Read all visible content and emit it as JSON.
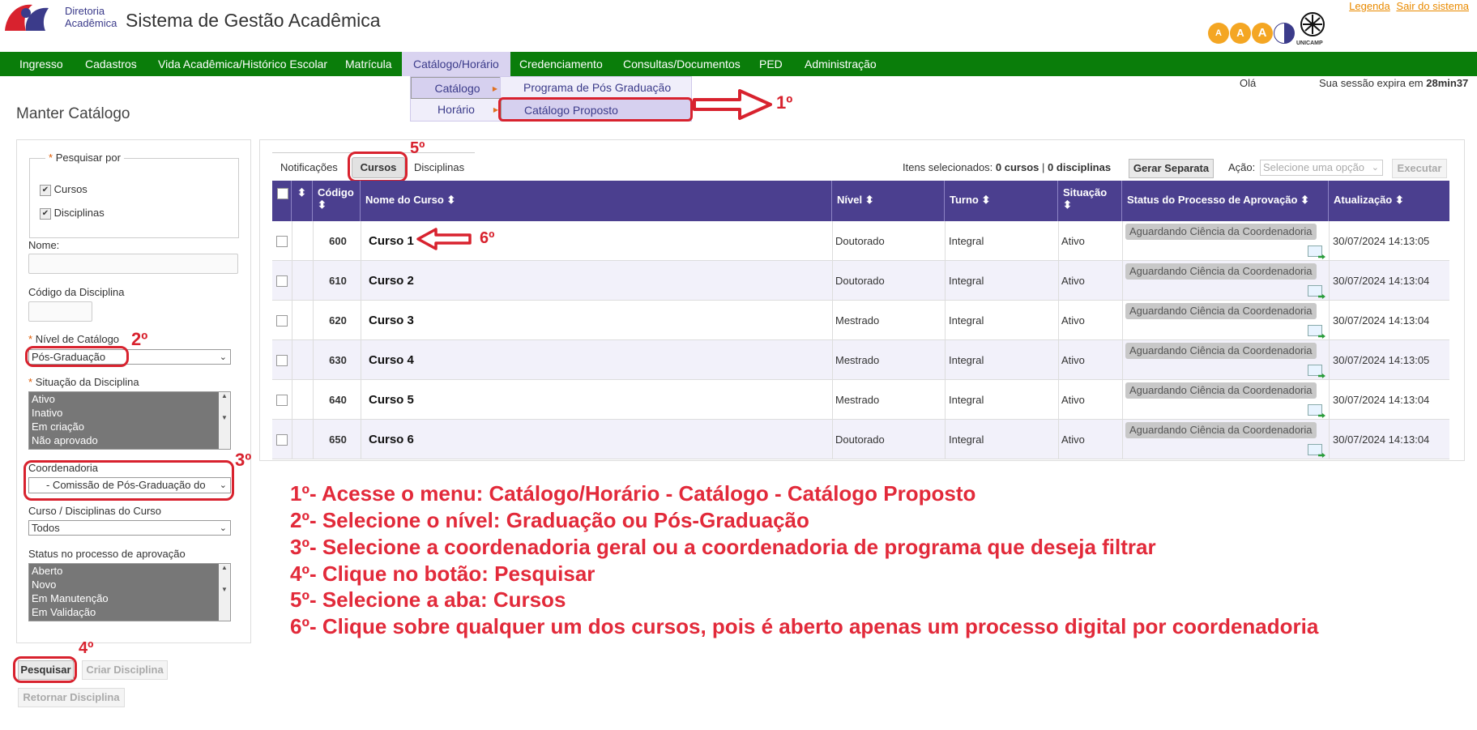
{
  "header": {
    "logo_line1": "Diretoria",
    "logo_line2": "Acadêmica",
    "title": "Sistema de Gestão Acadêmica",
    "link_legenda": "Legenda",
    "link_sair": "Sair do sistema",
    "accessibility": [
      "A",
      "A",
      "A"
    ],
    "unicamp": "UNICAMP"
  },
  "menu": {
    "items": [
      "Ingresso",
      "Cadastros",
      "Vida Acadêmica/Histórico Escolar",
      "Matrícula",
      "Catálogo/Horário",
      "Credenciamento",
      "Consultas/Documentos",
      "PED",
      "Administração"
    ],
    "submenu1": [
      "Catálogo",
      "Horário"
    ],
    "submenu2": [
      "Programa de Pós Graduação",
      "Catálogo Proposto"
    ]
  },
  "session": {
    "greeting": "Olá",
    "expires_label": "Sua sessão expira em",
    "expires_value": "28min37"
  },
  "page_title": "Manter Catálogo",
  "filters": {
    "search_by_label": "Pesquisar por",
    "opt_cursos": "Cursos",
    "opt_disciplinas": "Disciplinas",
    "nome_label": "Nome:",
    "codigo_label": "Código da Disciplina",
    "nivel_label": "Nível de Catálogo",
    "nivel_value": "Pós-Graduação",
    "situacao_label": "Situação da Disciplina",
    "situacao_options": [
      "Ativo",
      "Inativo",
      "Em criação",
      "Não aprovado"
    ],
    "coord_label": "Coordenadoria",
    "coord_value": "- Comissão de Pós-Graduação do",
    "curso_label": "Curso / Disciplinas do Curso",
    "curso_value": "Todos",
    "status_label": "Status no processo de aprovação",
    "status_options": [
      "Aberto",
      "Novo",
      "Em Manutenção",
      "Em Validação"
    ],
    "btn_pesquisar": "Pesquisar",
    "btn_criar": "Criar Disciplina",
    "btn_retornar": "Retornar Disciplina"
  },
  "tabs": [
    "Notificações",
    "Cursos",
    "Disciplinas"
  ],
  "selection": {
    "label": "Itens selecionados:",
    "courses": "0 cursos",
    "sep": "|",
    "disciplines": "0 disciplinas",
    "btn_gerar": "Gerar Separata",
    "acao_label": "Ação:",
    "acao_placeholder": "Selecione uma opção",
    "btn_executar": "Executar"
  },
  "table": {
    "headers": [
      "Código",
      "Nome do Curso",
      "Nível",
      "Turno",
      "Situação",
      "Status do Processo de Aprovação",
      "Atualização"
    ],
    "rows": [
      {
        "codigo": "600",
        "nome": "Curso 1",
        "nivel": "Doutorado",
        "turno": "Integral",
        "situacao": "Ativo",
        "status": "Aguardando Ciência da Coordenadoria",
        "atualizacao": "30/07/2024 14:13:05"
      },
      {
        "codigo": "610",
        "nome": "Curso 2",
        "nivel": "Doutorado",
        "turno": "Integral",
        "situacao": "Ativo",
        "status": "Aguardando Ciência da Coordenadoria",
        "atualizacao": "30/07/2024 14:13:04"
      },
      {
        "codigo": "620",
        "nome": "Curso 3",
        "nivel": "Mestrado",
        "turno": "Integral",
        "situacao": "Ativo",
        "status": "Aguardando Ciência da Coordenadoria",
        "atualizacao": "30/07/2024 14:13:04"
      },
      {
        "codigo": "630",
        "nome": "Curso 4",
        "nivel": "Mestrado",
        "turno": "Integral",
        "situacao": "Ativo",
        "status": "Aguardando Ciência da Coordenadoria",
        "atualizacao": "30/07/2024 14:13:05"
      },
      {
        "codigo": "640",
        "nome": "Curso 5",
        "nivel": "Mestrado",
        "turno": "Integral",
        "situacao": "Ativo",
        "status": "Aguardando Ciência da Coordenadoria",
        "atualizacao": "30/07/2024 14:13:04"
      },
      {
        "codigo": "650",
        "nome": "Curso 6",
        "nivel": "Doutorado",
        "turno": "Integral",
        "situacao": "Ativo",
        "status": "Aguardando Ciência da Coordenadoria",
        "atualizacao": "30/07/2024 14:13:04"
      }
    ]
  },
  "annotations": {
    "step1": "1º",
    "step2": "2º",
    "step3": "3º",
    "step4": "4º",
    "step5": "5º",
    "step6": "6º"
  },
  "instructions": [
    "1º- Acesse o menu: Catálogo/Horário - Catálogo - Catálogo Proposto",
    "2º- Selecione o nível: Graduação ou Pós-Graduação",
    "3º- Selecione a coordenadoria geral ou a coordenadoria de programa que deseja filtrar",
    "4º- Clique no botão: Pesquisar",
    "5º- Selecione a aba: Cursos",
    "6º- Clique sobre qualquer um dos cursos, pois é aberto apenas um processo digital por coordenadoria"
  ],
  "colors": {
    "menu_bg": "#0a7d0a",
    "table_header": "#4b3f8f",
    "annotation_red": "#d8222e",
    "accent_orange": "#e98a00"
  }
}
